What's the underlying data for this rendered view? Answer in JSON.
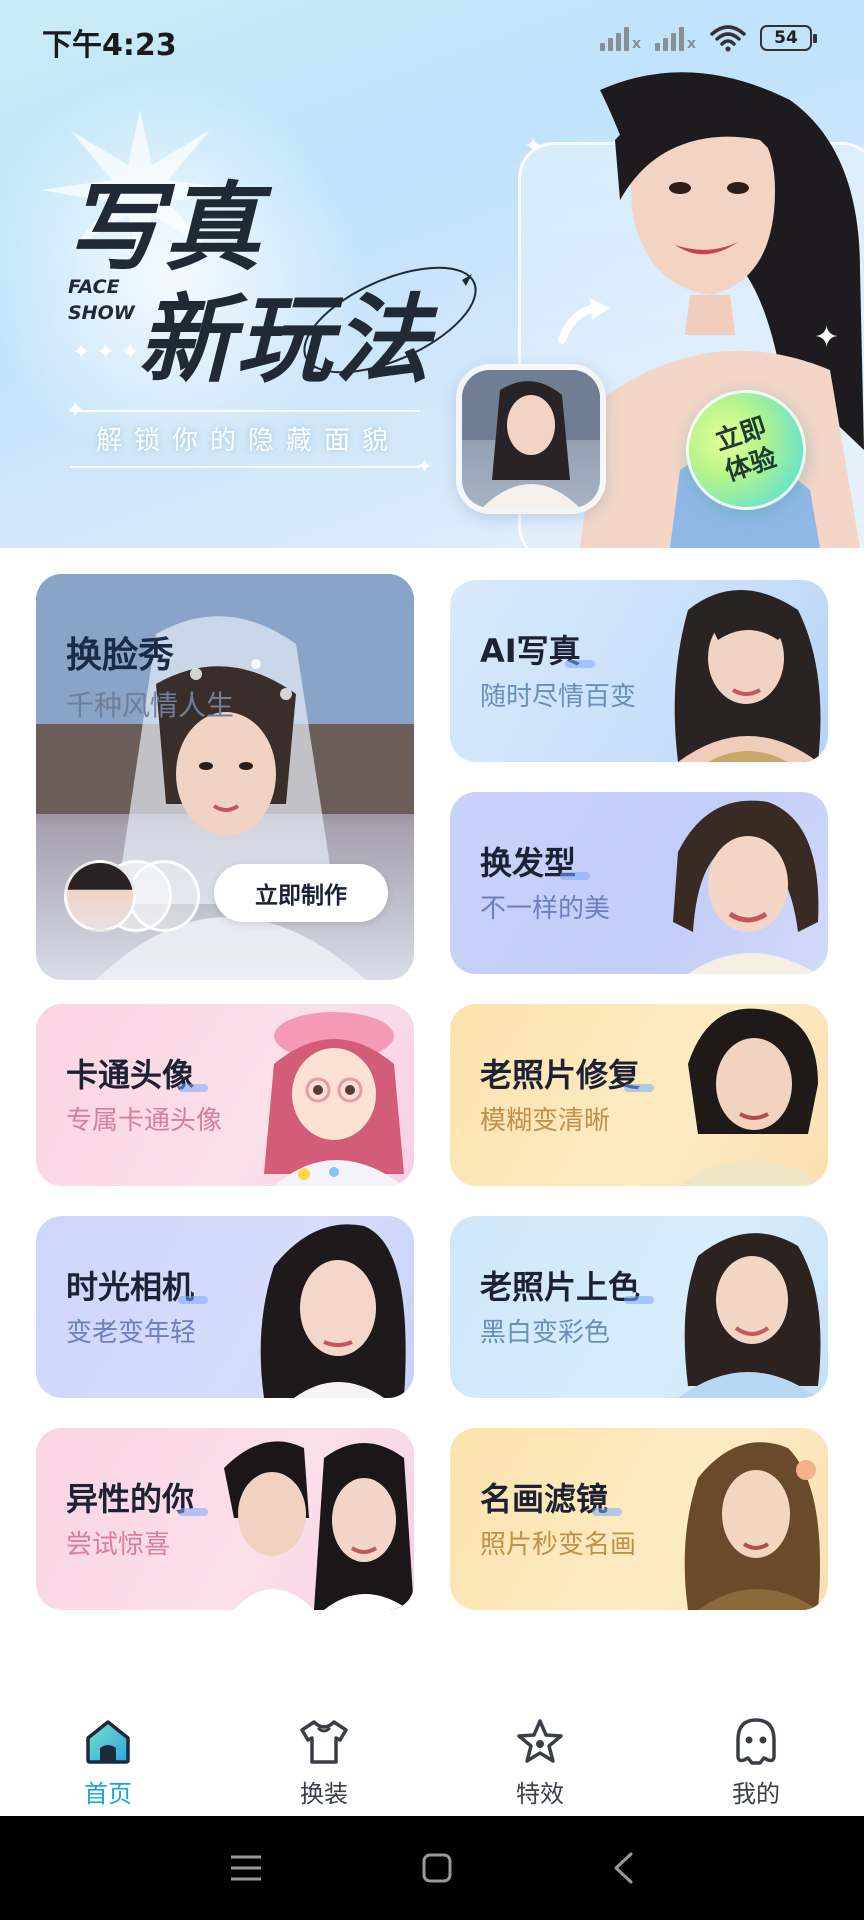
{
  "status_bar": {
    "time": "下午4:23",
    "battery": "54"
  },
  "hero": {
    "title_line1": "写真",
    "title_line2": "新玩法",
    "tag": "FACE SHOW",
    "tag_line1": "FACE",
    "tag_line2": "SHOW",
    "subtitle": "解锁你的隐藏面貌",
    "cta_line1": "立即",
    "cta_line2": "体验"
  },
  "featured_card": {
    "title": "换脸秀",
    "subtitle": "千种风情人生",
    "button": "立即制作"
  },
  "cards": [
    {
      "title": "AI写真",
      "subtitle": "随时尽情百变"
    },
    {
      "title": "换发型",
      "subtitle": "不一样的美"
    },
    {
      "title": "卡通头像",
      "subtitle": "专属卡通头像"
    },
    {
      "title": "老照片修复",
      "subtitle": "模糊变清晰"
    },
    {
      "title": "时光相机",
      "subtitle": "变老变年轻"
    },
    {
      "title": "老照片上色",
      "subtitle": "黑白变彩色"
    },
    {
      "title": "异性的你",
      "subtitle": "尝试惊喜"
    },
    {
      "title": "名画滤镜",
      "subtitle": "照片秒变名画"
    }
  ],
  "bottom_nav": [
    {
      "label": "首页",
      "icon": "home-icon",
      "active": true
    },
    {
      "label": "换装",
      "icon": "tshirt-icon",
      "active": false
    },
    {
      "label": "特效",
      "icon": "star-icon",
      "active": false
    },
    {
      "label": "我的",
      "icon": "profile-icon",
      "active": false
    }
  ],
  "colors": {
    "accent": "#1ba8d6",
    "nav_text": "#3a3f47"
  }
}
